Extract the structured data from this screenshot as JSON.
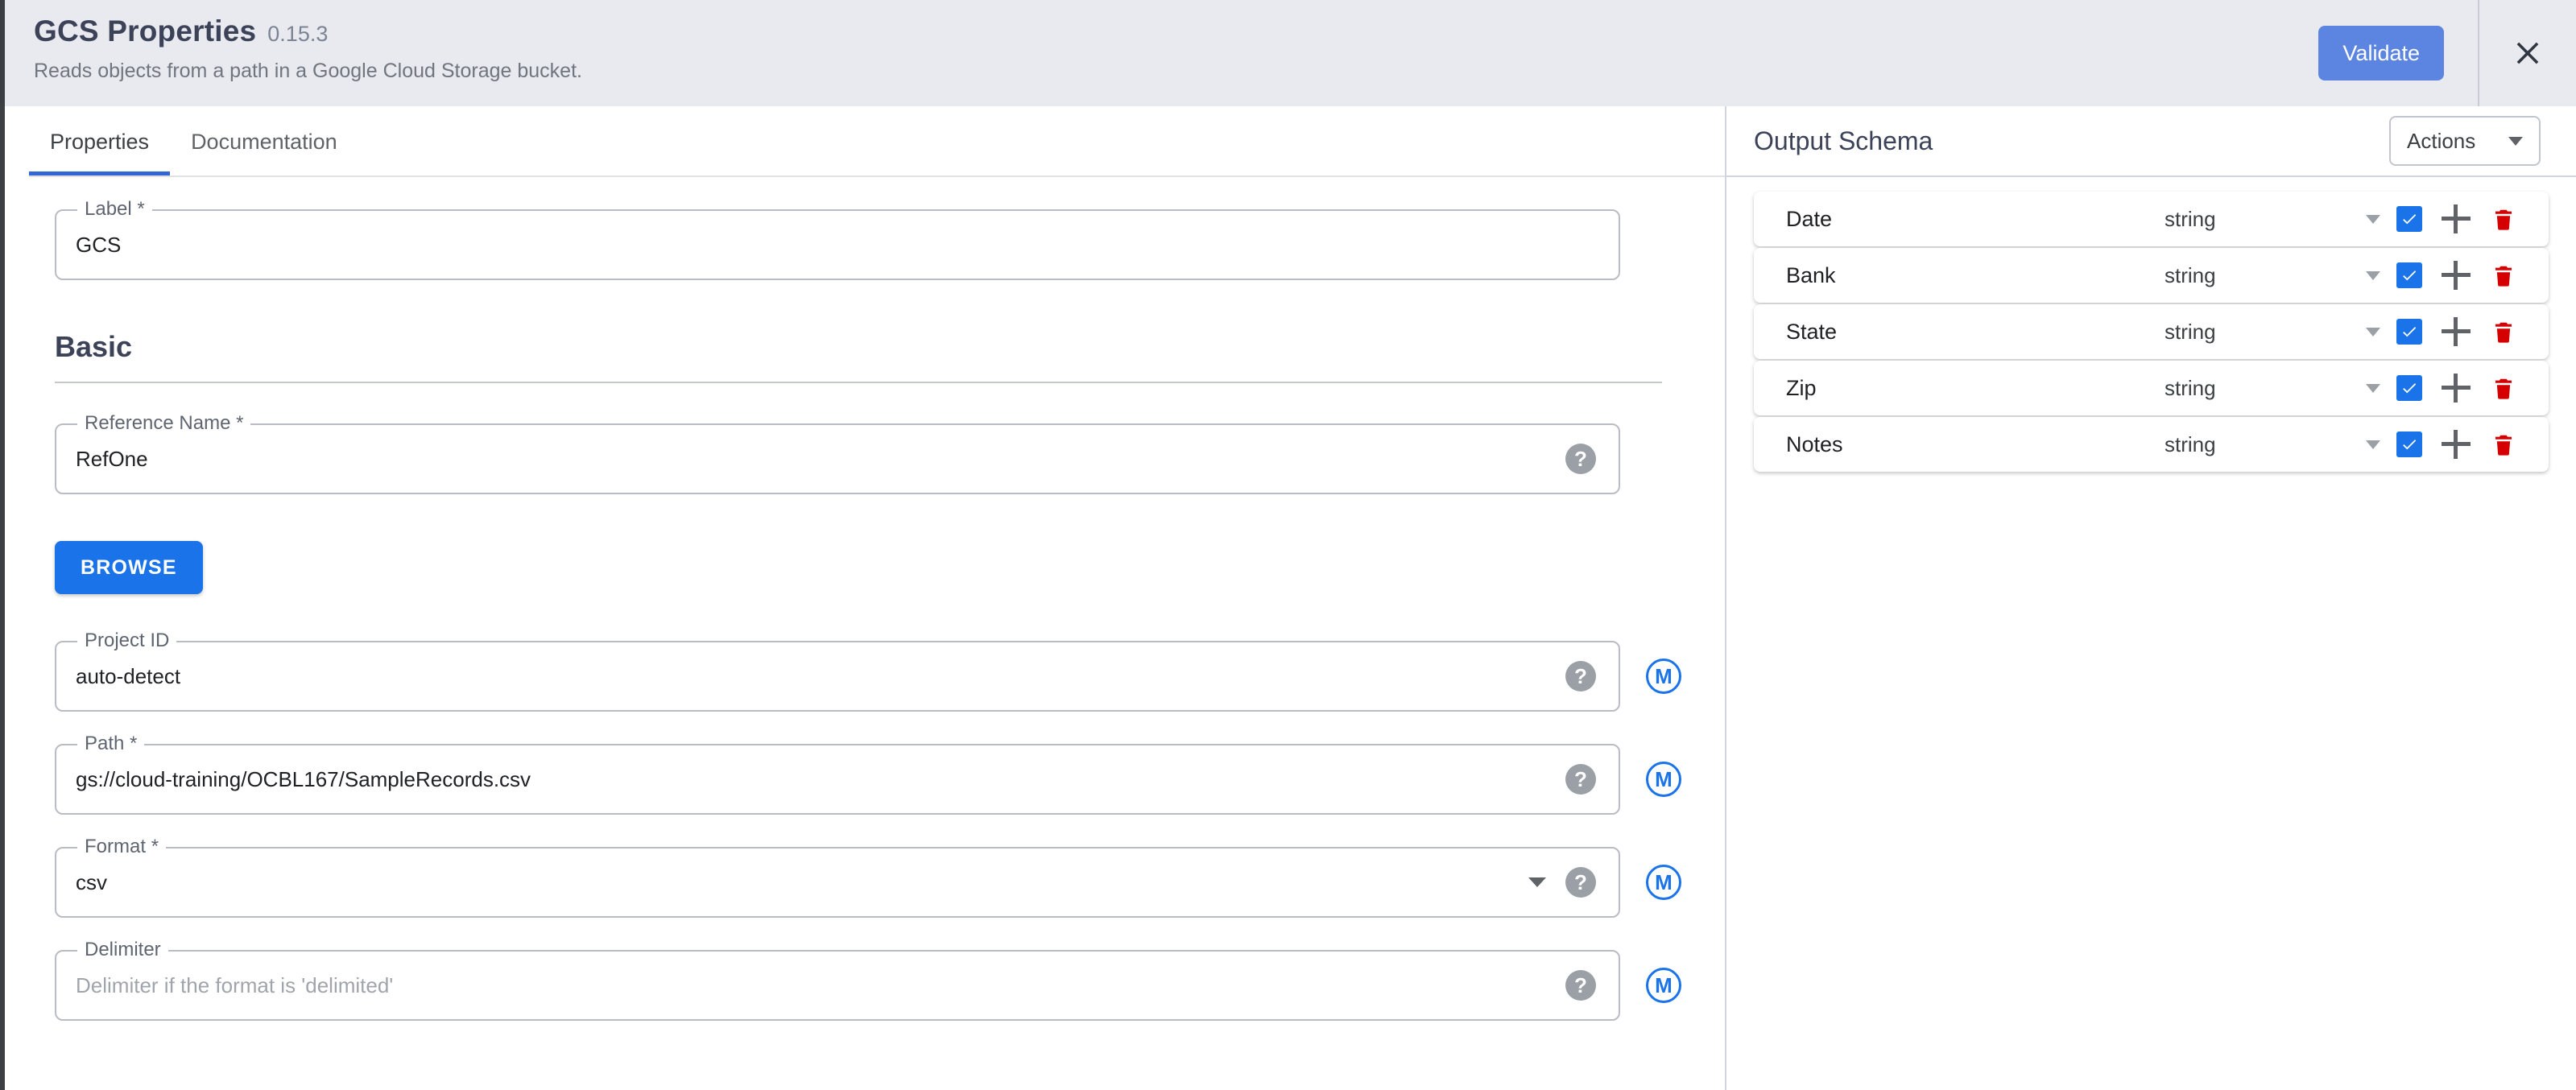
{
  "header": {
    "title": "GCS Properties",
    "version": "0.15.3",
    "subtitle": "Reads objects from a path in a Google Cloud Storage bucket.",
    "validate_label": "Validate",
    "close_icon": "close-icon",
    "accent_blue": "#5b85e0"
  },
  "tabs": [
    {
      "label": "Properties",
      "active": true
    },
    {
      "label": "Documentation",
      "active": false
    }
  ],
  "form": {
    "label_field": {
      "legend": "Label",
      "required": "*",
      "value": "GCS"
    },
    "section_title": "Basic",
    "reference_name": {
      "legend": "Reference Name",
      "required": "*",
      "value": "RefOne",
      "help_icon": "help-icon"
    },
    "browse_label": "BROWSE",
    "project_id": {
      "legend": "Project ID",
      "required": "",
      "value": "auto-detect",
      "macro": "M"
    },
    "path": {
      "legend": "Path",
      "required": "*",
      "value": "gs://cloud-training/OCBL167/SampleRecords.csv",
      "macro": "M"
    },
    "format": {
      "legend": "Format",
      "required": "*",
      "value": "csv",
      "macro": "M"
    },
    "delimiter": {
      "legend": "Delimiter",
      "required": "",
      "placeholder": "Delimiter if the format is 'delimited'",
      "macro": "M"
    }
  },
  "output_schema": {
    "title": "Output Schema",
    "actions_label": "Actions",
    "fields": [
      {
        "name": "Date",
        "type": "string",
        "selected": true
      },
      {
        "name": "Bank",
        "type": "string",
        "selected": true
      },
      {
        "name": "State",
        "type": "string",
        "selected": true
      },
      {
        "name": "Zip",
        "type": "string",
        "selected": true
      },
      {
        "name": "Notes",
        "type": "string",
        "selected": true
      }
    ],
    "checkbox_color": "#1a73e8",
    "delete_color": "#d50000"
  }
}
